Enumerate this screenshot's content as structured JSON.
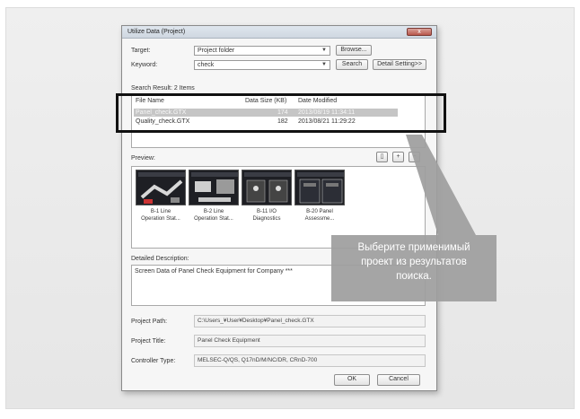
{
  "dialog": {
    "title": "Utilize Data (Project)",
    "close_label": "x",
    "target_label": "Target:",
    "target_value": "Project folder",
    "browse_label": "Browse...",
    "keyword_label": "Keyword:",
    "keyword_value": "check",
    "search_label": "Search",
    "detail_label": "Detail Setting>>",
    "result_label": "Search Result: 2 Items",
    "columns": {
      "name": "File Name",
      "size": "Data Size (KB)",
      "date": "Date Modified"
    },
    "rows": [
      {
        "name": "Panel_check.GTX",
        "size": "174",
        "date": "2013/08/19 11:34:11",
        "selected": true
      },
      {
        "name": "Quality_check.GTX",
        "size": "182",
        "date": "2013/08/21 11:29:22",
        "selected": false
      }
    ],
    "preview_label": "Preview:",
    "preview_tool_icons": [
      "page-icon",
      "zoom-in-icon",
      "zoom-out-icon"
    ],
    "previews": [
      {
        "line1": "B-1 Line",
        "line2": "Operation Stat..."
      },
      {
        "line1": "B-2 Line",
        "line2": "Operation Stat..."
      },
      {
        "line1": "B-11 I/O",
        "line2": "Diagnostics"
      },
      {
        "line1": "B-20 Panel",
        "line2": "Assessme..."
      }
    ],
    "desc_label": "Detailed Description:",
    "desc_value": "Screen Data of Panel Check Equipment for Company ***",
    "path_label": "Project Path:",
    "path_value": "C:\\Users_¥User¥Desktop¥Panel_check.GTX",
    "ptitle_label": "Project Title:",
    "ptitle_value": "Panel Check Equipment",
    "ctype_label": "Controller Type:",
    "ctype_value": "MELSEC-Q/QS, Q17nD/M/NC/DR, CRnD-700",
    "ok_label": "OK",
    "cancel_label": "Cancel"
  },
  "callout": {
    "line1": "Выберите применимый",
    "line2": "проект из результатов",
    "line3": "поиска."
  },
  "colors": {
    "callout_bg": "#9e9e9e",
    "selected_row": "#c5c5c5"
  }
}
